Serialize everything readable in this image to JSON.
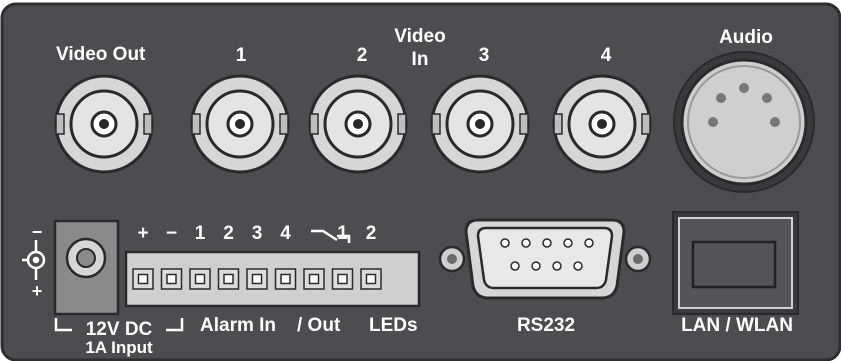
{
  "labels": {
    "video_out": "Video Out",
    "video_in_1": "1",
    "video_in_2": "2",
    "video_in_line1": "Video",
    "video_in_line2": "In",
    "video_in_3": "3",
    "video_in_4": "4",
    "audio": "Audio",
    "power_symbol_minus": "−",
    "power_symbol_plus": "+",
    "terminal_headers": [
      "+",
      "−",
      "1",
      "2",
      "3",
      "4",
      "⌐¬",
      "1",
      "2"
    ],
    "power_line1": "12V DC",
    "power_line2": "1A Input",
    "alarm_in": "Alarm In",
    "out": "/ Out",
    "leds": "LEDs",
    "rs232": "RS232",
    "lan_wlan": "LAN / WLAN"
  },
  "colors": {
    "panel": "#4d4d4f",
    "panel_dark": "#3a3a3c",
    "text": "#ffffff",
    "metal": "#d6d6d6",
    "metal_dark": "#8c8c8c",
    "terminal": "#cfcfcf",
    "jack": "#8a8a8a"
  }
}
